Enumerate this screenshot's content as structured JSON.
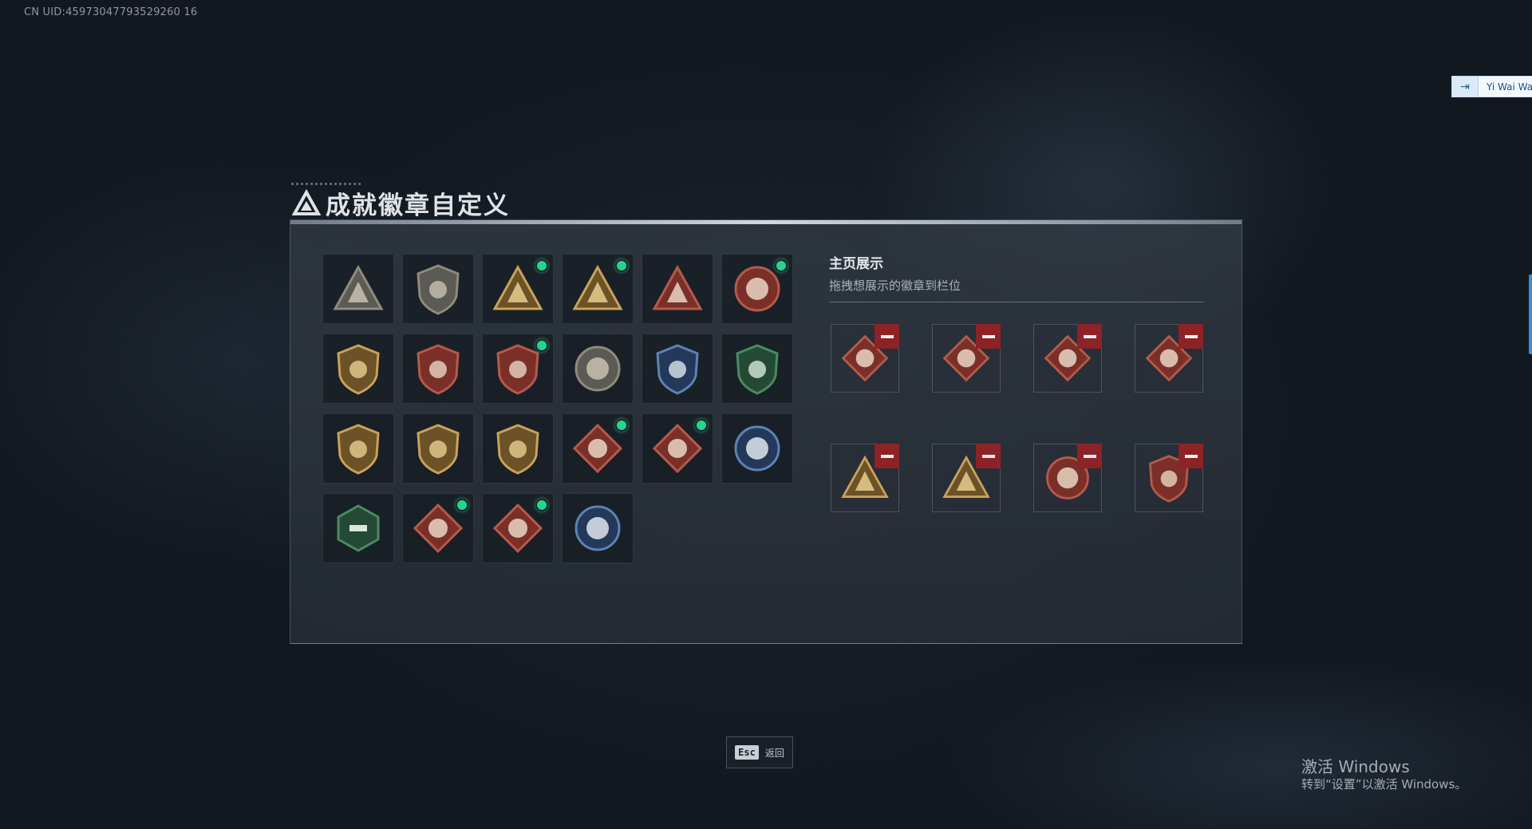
{
  "uid_label": "CN UID:45973047793529260 16",
  "user_chip": {
    "icon": "login-arrow-icon",
    "name": "Yi Wai Wai"
  },
  "title": "成就徽章自定义",
  "showcase": {
    "title": "主页展示",
    "subtitle": "拖拽想展示的徽章到栏位"
  },
  "badges": [
    {
      "icon": "shield-triangle-badge-icon",
      "new": false
    },
    {
      "icon": "helicopter-shield-badge-icon",
      "new": false
    },
    {
      "icon": "gold-55-triangle-badge-icon",
      "new": true
    },
    {
      "icon": "gold-boat-triangle-badge-icon",
      "new": true
    },
    {
      "icon": "red-number-one-badge-icon",
      "new": false
    },
    {
      "icon": "red-star-medal-badge-icon",
      "new": true
    },
    {
      "icon": "gold-anchor-shield-badge-icon",
      "new": false
    },
    {
      "icon": "red-ribbon-shield-badge-icon",
      "new": false
    },
    {
      "icon": "red-ribbon-shield-badge-2-icon",
      "new": true
    },
    {
      "icon": "bronze-tiger-coin-badge-icon",
      "new": false
    },
    {
      "icon": "blue-crosshair-shield-badge-icon",
      "new": false
    },
    {
      "icon": "green-crosshair-shield-badge-icon",
      "new": false
    },
    {
      "icon": "gold-rifle-shield-badge-icon",
      "new": false
    },
    {
      "icon": "gold-rifle-shield-badge-2-icon",
      "new": false
    },
    {
      "icon": "gold-crossed-swords-badge-icon",
      "new": false
    },
    {
      "icon": "red-wolf-diamond-badge-icon",
      "new": true
    },
    {
      "icon": "red-wolf-diamond-badge-2-icon",
      "new": true
    },
    {
      "icon": "blue-wolf-coin-badge-icon",
      "new": false
    },
    {
      "icon": "green-hexagon-gun-badge-icon",
      "new": false
    },
    {
      "icon": "red-dragon-diamond-badge-icon",
      "new": true
    },
    {
      "icon": "red-runner-diamond-badge-icon",
      "new": true
    },
    {
      "icon": "blue-wolf-coin-badge-2-icon",
      "new": false
    }
  ],
  "slots": [
    {
      "icon": "red-wolf-diamond-badge-icon"
    },
    {
      "icon": "red-dragon-diamond-badge-icon"
    },
    {
      "icon": "red-runner-diamond-badge-icon"
    },
    {
      "icon": "red-wolf-diamond-badge-2-icon"
    },
    {
      "icon": "gold-boat-triangle-badge-icon"
    },
    {
      "icon": "gold-55-triangle-badge-icon"
    },
    {
      "icon": "red-star-medal-badge-icon"
    },
    {
      "icon": "red-ribbon-shield-badge-2-icon"
    }
  ],
  "esc": {
    "key": "Esc",
    "label": "返回"
  },
  "windows_activation": {
    "title": "激活 Windows",
    "subtitle": "转到“设置”以激活 Windows。"
  },
  "colors": {
    "new_dot": "#25d58c",
    "remove_button": "#8d2227",
    "gold": "#c9a25a",
    "red": "#8e3b33"
  }
}
